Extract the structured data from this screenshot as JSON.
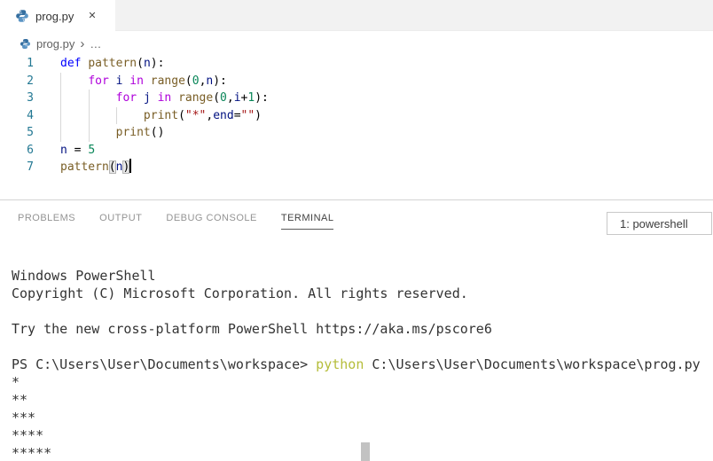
{
  "colors": {
    "keyword": "#0000ff",
    "control_keyword": "#af00db",
    "function_name": "#795e26",
    "variable": "#001080",
    "number": "#098658",
    "string": "#a31515",
    "line_number": "#237893",
    "terminal_command": "#b5bd3a",
    "tab_strip_bg": "#f2f2f2",
    "panel_tab_active": "#424242"
  },
  "tab": {
    "label": "prog.py",
    "close_icon": "✕",
    "file_icon": "python-icon"
  },
  "breadcrumb": {
    "file": "prog.py",
    "separator": "›",
    "more": "…"
  },
  "editor": {
    "lines": [
      {
        "num": "1",
        "tokens": [
          {
            "t": "def",
            "c": "kw"
          },
          {
            "t": " ",
            "c": "pl"
          },
          {
            "t": "pattern",
            "c": "fn"
          },
          {
            "t": "(",
            "c": "pl"
          },
          {
            "t": "n",
            "c": "var"
          },
          {
            "t": "):",
            "c": "pl"
          }
        ]
      },
      {
        "num": "2",
        "tokens": [
          {
            "t": "    ",
            "c": "pl"
          },
          {
            "t": "for",
            "c": "ctrl"
          },
          {
            "t": " ",
            "c": "pl"
          },
          {
            "t": "i",
            "c": "var"
          },
          {
            "t": " ",
            "c": "pl"
          },
          {
            "t": "in",
            "c": "ctrl"
          },
          {
            "t": " ",
            "c": "pl"
          },
          {
            "t": "range",
            "c": "fn"
          },
          {
            "t": "(",
            "c": "pl"
          },
          {
            "t": "0",
            "c": "num"
          },
          {
            "t": ",",
            "c": "pl"
          },
          {
            "t": "n",
            "c": "var"
          },
          {
            "t": "):",
            "c": "pl"
          }
        ]
      },
      {
        "num": "3",
        "tokens": [
          {
            "t": "        ",
            "c": "pl"
          },
          {
            "t": "for",
            "c": "ctrl"
          },
          {
            "t": " ",
            "c": "pl"
          },
          {
            "t": "j",
            "c": "var"
          },
          {
            "t": " ",
            "c": "pl"
          },
          {
            "t": "in",
            "c": "ctrl"
          },
          {
            "t": " ",
            "c": "pl"
          },
          {
            "t": "range",
            "c": "fn"
          },
          {
            "t": "(",
            "c": "pl"
          },
          {
            "t": "0",
            "c": "num"
          },
          {
            "t": ",",
            "c": "pl"
          },
          {
            "t": "i",
            "c": "var"
          },
          {
            "t": "+",
            "c": "pl"
          },
          {
            "t": "1",
            "c": "num"
          },
          {
            "t": "):",
            "c": "pl"
          }
        ]
      },
      {
        "num": "4",
        "tokens": [
          {
            "t": "            ",
            "c": "pl"
          },
          {
            "t": "print",
            "c": "fn"
          },
          {
            "t": "(",
            "c": "pl"
          },
          {
            "t": "\"*\"",
            "c": "str"
          },
          {
            "t": ",",
            "c": "pl"
          },
          {
            "t": "end",
            "c": "var"
          },
          {
            "t": "=",
            "c": "pl"
          },
          {
            "t": "\"\"",
            "c": "str"
          },
          {
            "t": ")",
            "c": "pl"
          }
        ]
      },
      {
        "num": "5",
        "tokens": [
          {
            "t": "        ",
            "c": "pl"
          },
          {
            "t": "print",
            "c": "fn"
          },
          {
            "t": "()",
            "c": "pl"
          }
        ]
      },
      {
        "num": "6",
        "tokens": [
          {
            "t": "n",
            "c": "var"
          },
          {
            "t": " = ",
            "c": "pl"
          },
          {
            "t": "5",
            "c": "num"
          }
        ]
      },
      {
        "num": "7",
        "cursor": true,
        "tokens": [
          {
            "t": "pattern",
            "c": "fn"
          },
          {
            "t": "(",
            "c": "brk"
          },
          {
            "t": "n",
            "c": "var"
          },
          {
            "t": ")",
            "c": "brk"
          }
        ]
      }
    ]
  },
  "panel": {
    "tabs": [
      {
        "label": "PROBLEMS",
        "active": false
      },
      {
        "label": "OUTPUT",
        "active": false
      },
      {
        "label": "DEBUG CONSOLE",
        "active": false
      },
      {
        "label": "TERMINAL",
        "active": true
      }
    ],
    "terminal_select": "1: powershell"
  },
  "terminal": {
    "lines": [
      [
        {
          "t": "Windows PowerShell"
        }
      ],
      [
        {
          "t": "Copyright (C) Microsoft Corporation. All rights reserved."
        }
      ],
      [],
      [
        {
          "t": "Try the new cross-platform PowerShell https://aka.ms/pscore6"
        }
      ],
      [],
      [
        {
          "t": "PS C:\\Users\\User\\Documents\\workspace> "
        },
        {
          "t": "python",
          "c": "cmd"
        },
        {
          "t": " C:\\Users\\User\\Documents\\workspace\\prog.py"
        }
      ],
      [
        {
          "t": "*"
        }
      ],
      [
        {
          "t": "**"
        }
      ],
      [
        {
          "t": "***"
        }
      ],
      [
        {
          "t": "****"
        }
      ],
      [
        {
          "t": "*****"
        }
      ]
    ]
  }
}
